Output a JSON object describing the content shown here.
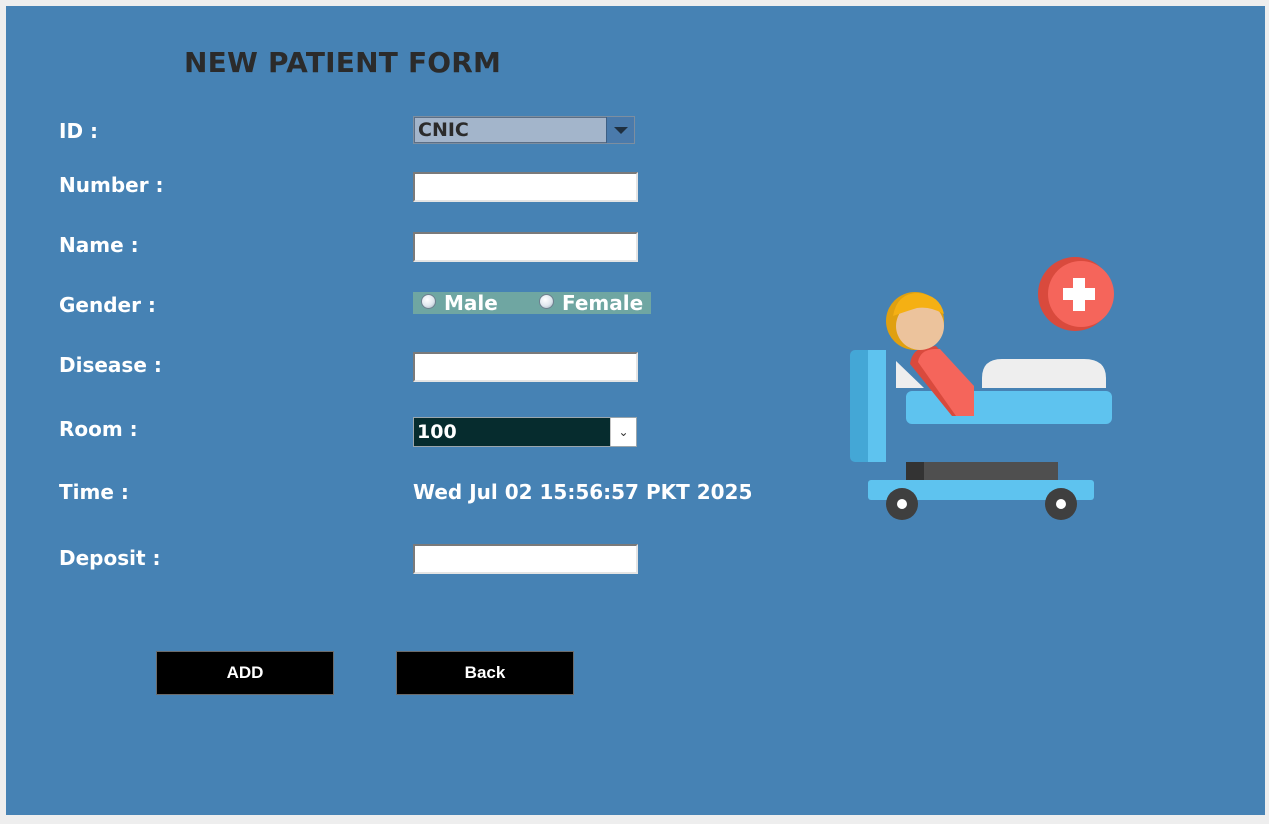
{
  "title": "NEW PATIENT FORM",
  "labels": {
    "id": "ID :",
    "number": "Number :",
    "name": "Name :",
    "gender": "Gender :",
    "disease": "Disease :",
    "room": "Room :",
    "time": "Time :",
    "deposit": "Deposit :"
  },
  "fields": {
    "id_type": {
      "selected": "CNIC",
      "icon": "caret-down-icon"
    },
    "number": {
      "value": ""
    },
    "name": {
      "value": ""
    },
    "gender": {
      "options": [
        "Male",
        "Female"
      ],
      "selected": null
    },
    "disease": {
      "value": ""
    },
    "room": {
      "selected": "100",
      "icon": "chevron-down-icon"
    },
    "time": {
      "value": "Wed Jul 02 15:56:57 PKT 2025"
    },
    "deposit": {
      "value": ""
    }
  },
  "buttons": {
    "add": "ADD",
    "back": "Back"
  },
  "illustration": {
    "icon": "hospital-bed-patient-icon",
    "badge_icon": "medical-cross-icon"
  },
  "colors": {
    "background": "#4682b4",
    "title": "#2b2b2b",
    "label": "#ffffff",
    "button": "#000000",
    "gender_group": "#6fa6a2",
    "room_combo": "#062c2e",
    "id_combo": "#a3b5cb"
  }
}
